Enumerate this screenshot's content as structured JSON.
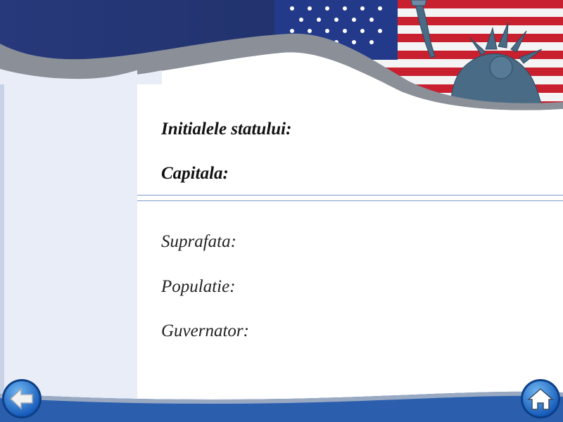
{
  "fields": {
    "state_initials_label": "Initialele statului:",
    "capital_label": "Capitala:",
    "area_label": "Suprafata:",
    "population_label": "Populatie:",
    "governor_label": "Guvernator:"
  },
  "navigation": {
    "back_icon": "arrow-left-icon",
    "home_icon": "home-icon"
  },
  "colors": {
    "navy": "#1f3370",
    "sidebar": "#e9edf8",
    "flag_red": "#c8202f",
    "accent_blue": "#2b63b8"
  }
}
